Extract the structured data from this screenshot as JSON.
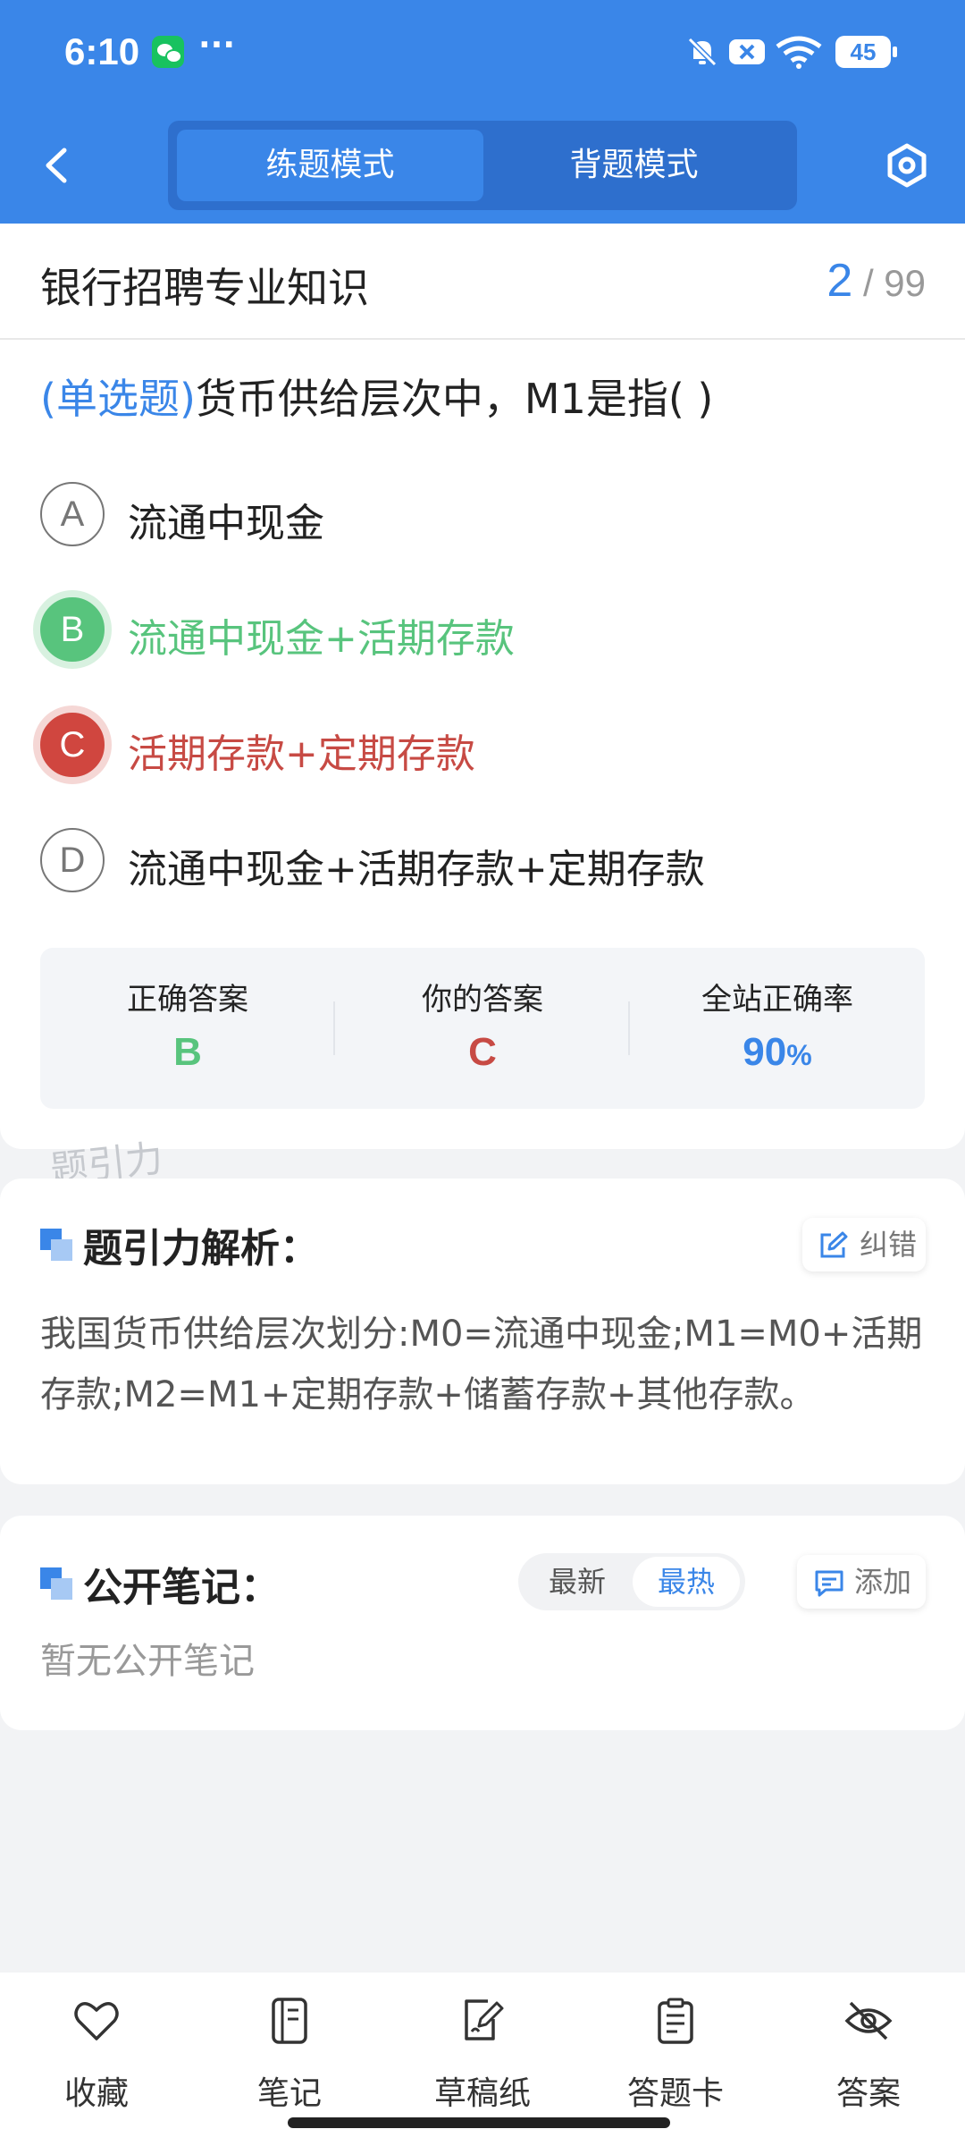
{
  "status": {
    "time": "6:10",
    "dots": "···",
    "battery": "45"
  },
  "header": {
    "mode_practice": "练题模式",
    "mode_memorize": "背题模式"
  },
  "question": {
    "bank_title": "银行招聘专业知识",
    "current": "2",
    "total": "/ 99",
    "type_label": "(单选题)",
    "text": "货币供给层次中，M1是指(        )",
    "options": [
      {
        "letter": "A",
        "text": "流通中现金",
        "state": "normal"
      },
      {
        "letter": "B",
        "text": "流通中现金+活期存款",
        "state": "correct"
      },
      {
        "letter": "C",
        "text": "活期存款+定期存款",
        "state": "wrong"
      },
      {
        "letter": "D",
        "text": "流通中现金+活期存款+定期存款",
        "state": "normal"
      }
    ]
  },
  "stats": {
    "correct_label": "正确答案",
    "correct_value": "B",
    "yours_label": "你的答案",
    "yours_value": "C",
    "rate_label": "全站正确率",
    "rate_value": "90",
    "rate_unit": "%"
  },
  "watermark": "题引力",
  "analysis": {
    "title": "题引力解析：",
    "report_label": "纠错",
    "text": "我国货币供给层次划分:M0=流通中现金;M1=M0+活期存款;M2=M1+定期存款+储蓄存款+其他存款。"
  },
  "notes": {
    "title": "公开笔记：",
    "sort_newest": "最新",
    "sort_hottest": "最热",
    "add_label": "添加",
    "empty_text": "暂无公开笔记"
  },
  "bottom": {
    "favorite": "收藏",
    "notes": "笔记",
    "scratch": "草稿纸",
    "answer_card": "答题卡",
    "answer": "答案"
  },
  "colors": {
    "primary": "#3a86e8",
    "correct": "#58c47d",
    "wrong": "#d0463f"
  }
}
